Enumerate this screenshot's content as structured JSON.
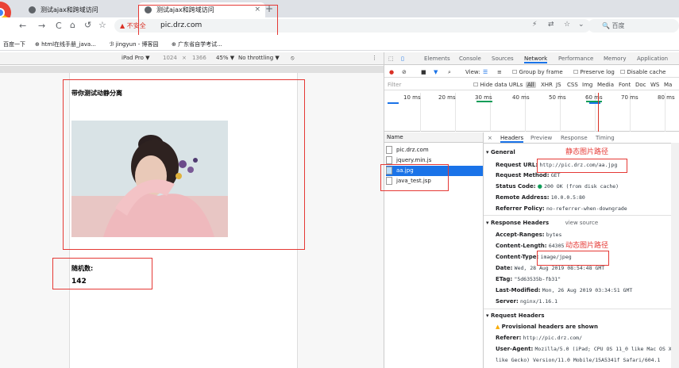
{
  "browser": {
    "tabs": [
      {
        "title": "测试ajax和跨域访问"
      },
      {
        "title": "测试ajax和跨域访问"
      }
    ],
    "new_tab": "+",
    "tab_close": "×",
    "nav": {
      "back": "←",
      "forward": "→",
      "reload": "C",
      "home": "⌂",
      "undo": "↺",
      "star": "☆"
    },
    "omnibox": {
      "security": "不安全",
      "url": "pic.drz.com"
    },
    "search_engine": "百度",
    "bookmarks": [
      "百度一下",
      "html在线手册_java...",
      "jingyun - 博客园",
      "广东省自学考试..."
    ]
  },
  "device_toolbar": {
    "device": "iPad Pro ▼",
    "width": "1024",
    "height": "1366",
    "zoom": "45% ▼",
    "throttle": "No throttling ▼"
  },
  "page": {
    "heading": "带你测试动静分离",
    "random_label": "随机数:",
    "random_value": "142"
  },
  "devtools": {
    "tabs": [
      "Elements",
      "Console",
      "Sources",
      "Network",
      "Performance",
      "Memory",
      "Application"
    ],
    "active_tab": "Network",
    "network_options": {
      "view": "View:",
      "group": "Group by frame",
      "preserve": "Preserve log",
      "disable_cache": "Disable cache"
    },
    "filter": {
      "placeholder": "Filter",
      "hide_data": "Hide data URLs",
      "types": [
        "All",
        "XHR",
        "JS",
        "CSS",
        "Img",
        "Media",
        "Font",
        "Doc",
        "WS",
        "Ma"
      ]
    },
    "timeline_ticks": [
      "10 ms",
      "20 ms",
      "30 ms",
      "40 ms",
      "50 ms",
      "60 ms",
      "70 ms",
      "80 ms"
    ],
    "list_header": "Name",
    "requests": [
      "pic.drz.com",
      "jquery.min.js",
      "aa.jpg",
      "java_test.jsp"
    ],
    "selected_request": "aa.jpg",
    "detail_close": "×",
    "detail_tabs": [
      "Headers",
      "Preview",
      "Response",
      "Timing"
    ],
    "general": {
      "title": "▾ General",
      "request_url_label": "Request URL:",
      "request_url": "http://pic.drz.com/aa.jpg",
      "method_label": "Request Method:",
      "method": "GET",
      "status_label": "Status Code:",
      "status": "200 OK (from disk cache)",
      "remote_label": "Remote Address:",
      "remote": "10.0.0.5:80",
      "referrer_label": "Referrer Policy:",
      "referrer": "no-referrer-when-downgrade"
    },
    "response_headers": {
      "title": "▾ Response Headers",
      "view_source": "view source",
      "rows": [
        {
          "label": "Accept-Ranges:",
          "value": "bytes"
        },
        {
          "label": "Content-Length:",
          "value": "64305"
        },
        {
          "label": "Content-Type:",
          "value": "image/jpeg"
        },
        {
          "label": "Date:",
          "value": "Wed, 28 Aug 2019 08:54:48 GMT"
        },
        {
          "label": "ETag:",
          "value": "\"5d63535b-fb31\""
        },
        {
          "label": "Last-Modified:",
          "value": "Mon, 26 Aug 2019 03:34:51 GMT"
        },
        {
          "label": "Server:",
          "value": "nginx/1.16.1"
        }
      ]
    },
    "request_headers": {
      "title": "▾ Request Headers",
      "warning": "Provisional headers are shown",
      "referer_label": "Referer:",
      "referer": "http://pic.drz.com/",
      "ua_label": "User-Agent:",
      "ua": "Mozilla/5.0 (iPad; CPU OS 11_0 like Mac OS X",
      "ua2": "like Gecko) Version/11.0 Mobile/15A5341f Safari/604.1"
    }
  },
  "annotations": {
    "static_path": "静态图片路径",
    "dynamic_path": "动态图片路径"
  },
  "colors": {
    "annotation": "#e53935",
    "accent": "#1a73e8",
    "selected_row": "#1a73e8"
  }
}
